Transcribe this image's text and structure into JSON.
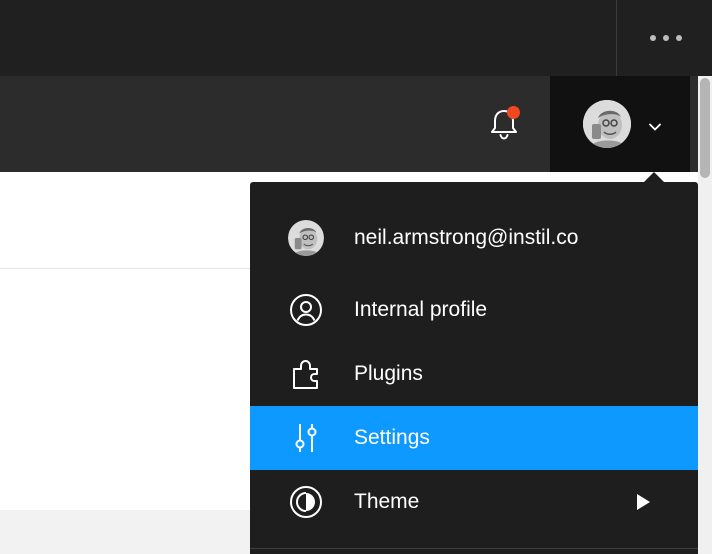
{
  "titlebar": {
    "more_icon": "more-horizontal-icon"
  },
  "toolbar": {
    "notification_icon": "bell-icon",
    "notification_badge_color": "#f24822",
    "account_icon": "avatar",
    "account_chevron": "chevron-down-icon"
  },
  "account_menu": {
    "items": [
      {
        "label": "neil.armstrong@instil.co",
        "icon": "avatar"
      },
      {
        "label": "Internal profile",
        "icon": "user-circle-icon"
      },
      {
        "label": "Plugins",
        "icon": "puzzle-icon"
      },
      {
        "label": "Settings",
        "icon": "sliders-icon",
        "active": true
      },
      {
        "label": "Theme",
        "icon": "contrast-icon",
        "submenu": true
      }
    ]
  },
  "colors": {
    "titlebar_bg": "#202020",
    "toolbar_bg": "#2c2c2c",
    "menu_bg": "#1e1e1e",
    "accent": "#0d99ff",
    "text": "#ffffff"
  }
}
